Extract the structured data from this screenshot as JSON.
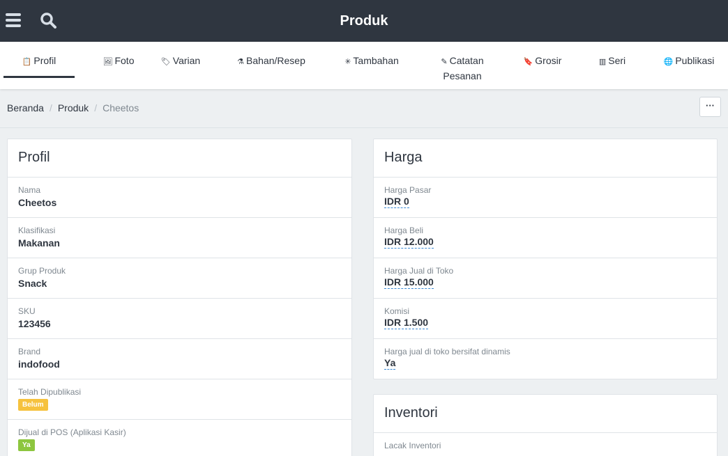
{
  "header": {
    "title": "Produk"
  },
  "tabs": [
    {
      "label": "Profil",
      "icon": "clipboard-icon",
      "glyph": "📋"
    },
    {
      "label": "Foto",
      "icon": "image-icon",
      "glyph": "🖼"
    },
    {
      "label": "Varian",
      "icon": "tag-icon",
      "glyph": "🏷"
    },
    {
      "label": "Bahan/Resep",
      "icon": "flask-icon",
      "glyph": "⚗"
    },
    {
      "label": "Tambahan",
      "icon": "sparkle-icon",
      "glyph": "✳"
    },
    {
      "label": "Catatan",
      "label2": "Pesanan",
      "icon": "note-icon",
      "glyph": "✎"
    },
    {
      "label": "Grosir",
      "icon": "bookmark-icon",
      "glyph": "🔖"
    },
    {
      "label": "Seri",
      "icon": "barcode-icon",
      "glyph": "▥"
    },
    {
      "label": "Publikasi",
      "icon": "globe-icon",
      "glyph": "🌐"
    }
  ],
  "breadcrumb": {
    "home": "Beranda",
    "section": "Produk",
    "current": "Cheetos"
  },
  "more_button": "···",
  "profil": {
    "title": "Profil",
    "fields": [
      {
        "label": "Nama",
        "value": "Cheetos"
      },
      {
        "label": "Klasifikasi",
        "value": "Makanan"
      },
      {
        "label": "Grup Produk",
        "value": "Snack"
      },
      {
        "label": "SKU",
        "value": "123456"
      },
      {
        "label": "Brand",
        "value": "indofood"
      }
    ],
    "published": {
      "label": "Telah Dipublikasi",
      "value": "Belum"
    },
    "pos": {
      "label": "Dijual di POS (Aplikasi Kasir)",
      "value": "Ya"
    }
  },
  "harga": {
    "title": "Harga",
    "fields": [
      {
        "label": "Harga Pasar",
        "value": "IDR 0"
      },
      {
        "label": "Harga Beli",
        "value": "IDR 12.000"
      },
      {
        "label": "Harga Jual di Toko",
        "value": "IDR 15.000"
      },
      {
        "label": "Komisi",
        "value": "IDR 1.500"
      },
      {
        "label": "Harga jual di toko bersifat dinamis",
        "value": "Ya"
      }
    ]
  },
  "inventori": {
    "title": "Inventori",
    "first_label": "Lacak Inventori"
  },
  "colors": {
    "topbar": "#2f3640",
    "badge_warn": "#f6c23e",
    "badge_ok": "#8dc63f",
    "link_underline": "#3a8ad6"
  }
}
